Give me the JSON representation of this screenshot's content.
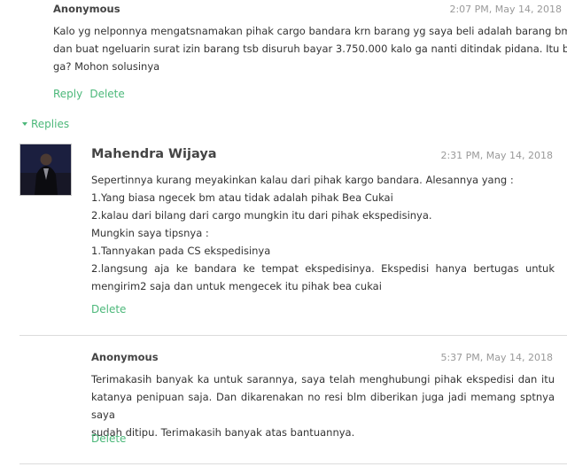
{
  "comment1": {
    "author": "Anonymous",
    "timestamp": "2:07 PM, May 14, 2018",
    "lines": [
      "Kalo yg nelponnya mengatsnamakan pihak cargo bandara krn barang yg saya beli adalah barang bm",
      "dan buat ngeluarin surat izin barang tsb disuruh bayar 3.750.000 kalo ga nanti ditindak pidana. Itu benar",
      "ga? Mohon solusinya"
    ],
    "reply_label": "Reply",
    "delete_label": "Delete"
  },
  "replies_toggle": {
    "label": "Replies"
  },
  "reply1": {
    "author": "Mahendra Wijaya",
    "timestamp": "2:31 PM, May 14, 2018",
    "lines": [
      "Sepertinnya kurang meyakinkan kalau dari pihak kargo bandara. Alesannya yang :",
      "1.Yang biasa ngecek bm atau tidak adalah pihak Bea Cukai",
      "2.kalau dari bilang dari cargo mungkin itu dari pihak ekspedisinya.",
      "Mungkin saya tipsnya :",
      "1.Tannyakan pada CS ekspedisinya",
      "2.langsung aja ke bandara ke tempat ekspedisinya. Ekspedisi hanya bertugas untuk",
      "mengirim2 saja dan untuk mengecek itu pihak bea cukai"
    ],
    "delete_label": "Delete",
    "avatar_icon": "user-photo-avatar"
  },
  "reply2": {
    "author": "Anonymous",
    "timestamp": "5:37 PM, May 14, 2018",
    "lines": [
      "Terimakasih banyak ka untuk sarannya, saya telah menghubungi pihak ekspedisi dan itu",
      "katanya penipuan saja. Dan dikarenakan no resi blm diberikan juga jadi memang sptnya saya",
      "sudah ditipu. Terimakasih banyak atas bantuannya."
    ],
    "delete_label": "Delete"
  },
  "colors": {
    "accent": "#4cb87a",
    "text": "#333333",
    "muted": "#9a9a9a",
    "divider": "#dcdcdc"
  }
}
